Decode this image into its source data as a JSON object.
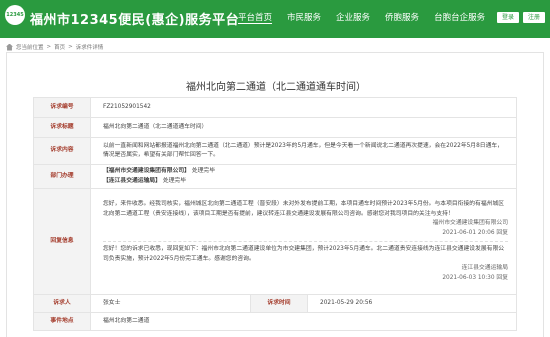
{
  "header": {
    "logo_text": "12345",
    "site_title": "福州市12345便民(惠企)服务平台",
    "nav": [
      "平台首页",
      "市民服务",
      "企业服务",
      "侨胞服务",
      "台胞台企服务"
    ],
    "login_label": "登录",
    "register_label": "注册"
  },
  "breadcrumb": [
    "您当前位置",
    "首页",
    "诉求件详情"
  ],
  "page_title": "福州北向第二通道（北二通道通车时间）",
  "table": {
    "labels": {
      "id": "诉求编号",
      "title": "诉求标题",
      "content": "诉求内容",
      "dept": "部门办理",
      "reply": "回复信息",
      "submitter": "诉求人",
      "submit_time_label": "诉求时间",
      "location": "事件地点"
    },
    "id": "FZ21052901542",
    "title": "福州北向第二通道（北二通道通车时间）",
    "content": "以前一直新闻和网站都报道福州北向第二通道（北二通道）预计是2023年的5月通车，但是今天看一个新闻说北二通道再次提速，会在2022年5月8日通车，情况是否属实，希望有关部门帮忙回答一下。",
    "dept": [
      {
        "name": "【福州市交通建设集团有限公司】",
        "status": "处理完毕"
      },
      {
        "name": "【连江县交通运输局】",
        "status": "处理完毕"
      }
    ],
    "replies": [
      {
        "text": "您好，来件收悉。经我司核实，福州城区北向第二通道工程（晋安段）未对外发布提前工期，本项目通车时间预计2023年5月份。与本项目衔接的有福州城区北向第二通道工程（贵安连接线），该项目工期是否有提前，建议转连江县交通建设发展有限公司咨询。感谢您对我司项目的关注与支持！",
        "org": "福州市交通建设集团有限公司",
        "time": "2021-06-01 20:06 回复"
      },
      {
        "text": "您好！您的诉求已收悉，现回复如下：福州市北向第二通道建设单位为市交建集团，预计2023年5月通车。北二通道贵安连接线为连江县交通建设发展有限公司负责实施，预计2022年5月份完工通车。感谢您的咨询。",
        "org": "连江县交通运输局",
        "time": "2021-06-03 10:30 回复"
      }
    ],
    "submitter": "张女士",
    "submit_time": "2021-05-29 20:56",
    "location": "福州北向第二通道"
  }
}
